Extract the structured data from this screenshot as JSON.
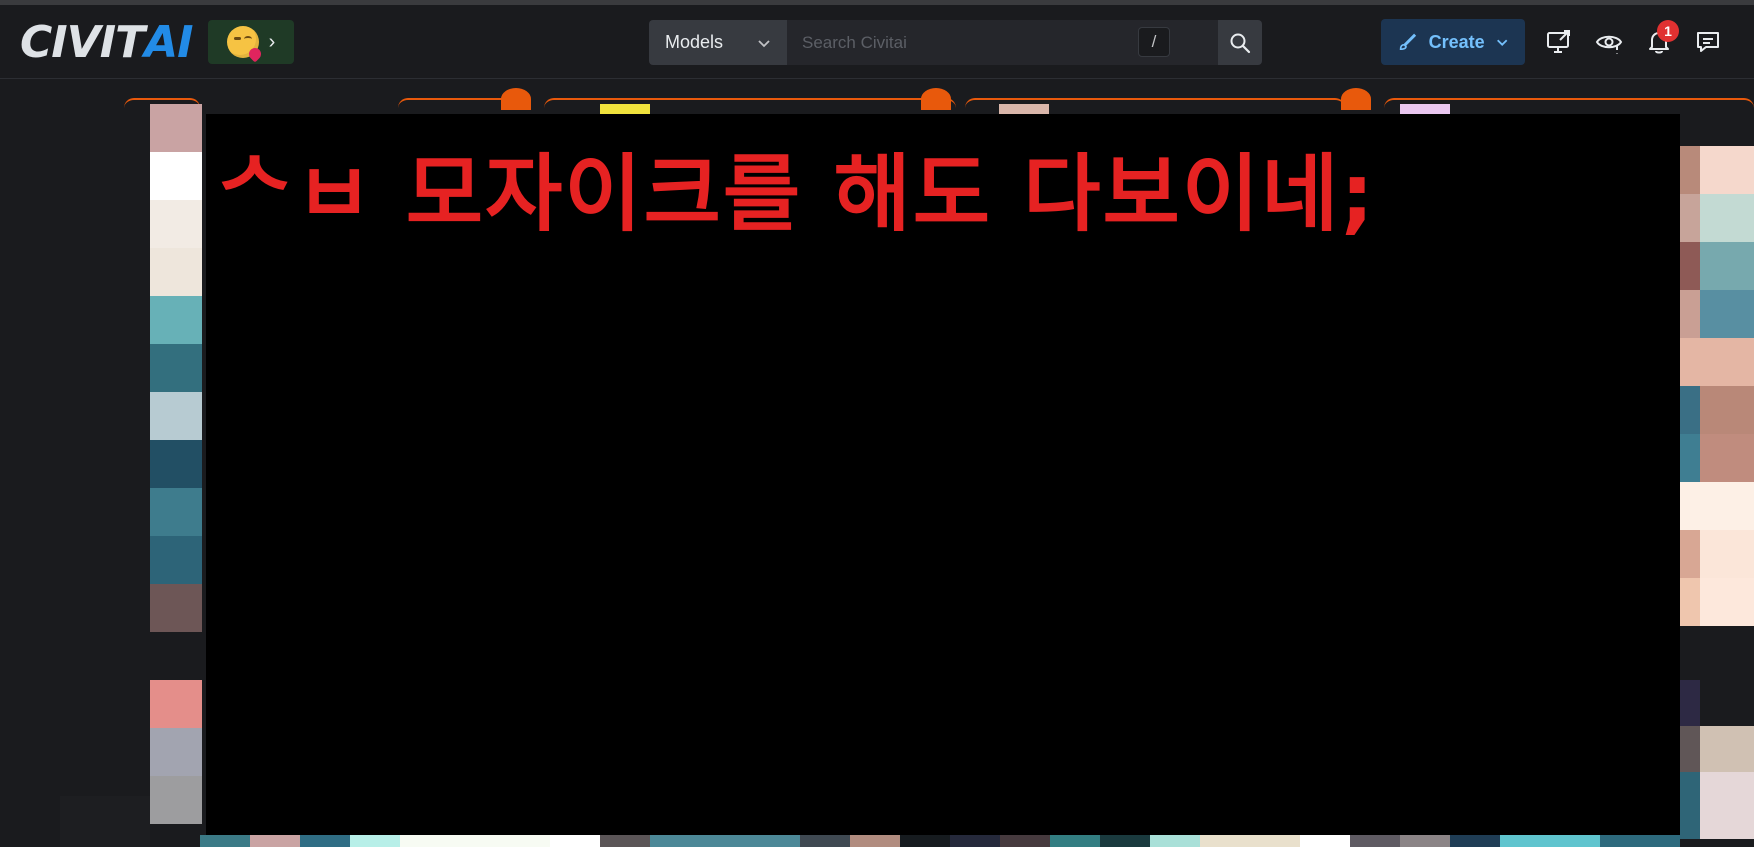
{
  "header": {
    "logo_part1": "CIVIT",
    "logo_part2": "AI",
    "emoji_button_icon": "kissing-face-with-heart-emoji",
    "search": {
      "category_value": "Models",
      "placeholder": "Search Civitai",
      "shortcut_key": "/"
    },
    "create_label": "Create",
    "notification_count": "1"
  },
  "overlay": {
    "text": "ᄉㅂ 모자이크를 해도 다보이네;"
  },
  "colors": {
    "accent": "#228be6",
    "create_bg": "#1c3552",
    "create_fg": "#74c0fc",
    "pin_orange": "#e8590c",
    "overlay_text": "#e62222",
    "badge": "#e03131"
  }
}
